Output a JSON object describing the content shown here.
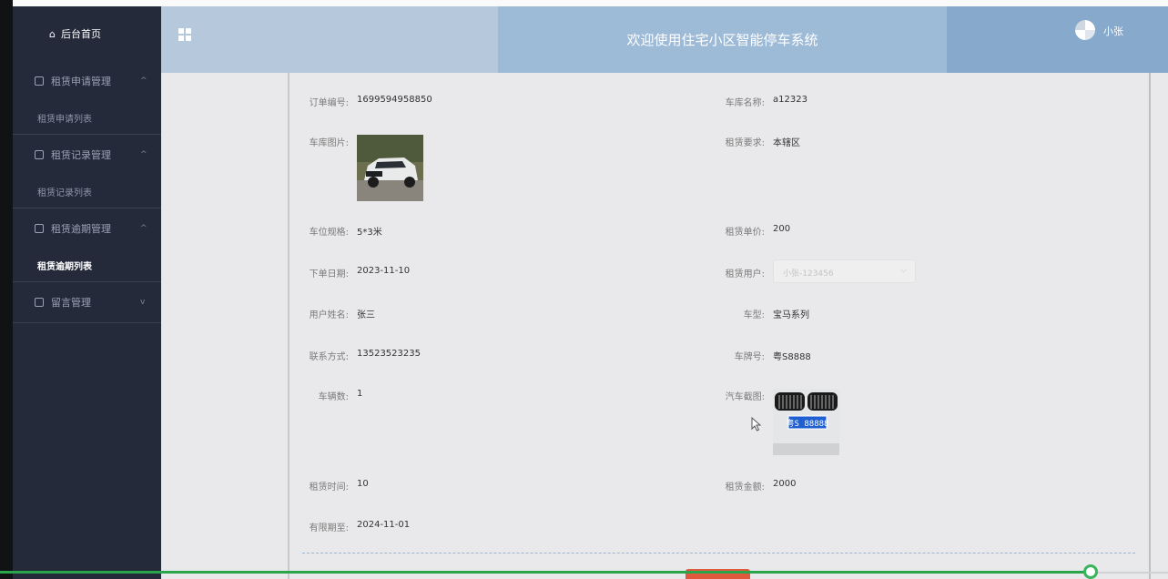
{
  "header": {
    "title": "欢迎使用住宅小区智能停车系统",
    "username": "小张"
  },
  "sidebar": {
    "home": "后台首页",
    "groups": [
      {
        "title": "租赁申请管理",
        "chevron": "^",
        "items": [
          "租赁申请列表"
        ]
      },
      {
        "title": "租赁记录管理",
        "chevron": "^",
        "items": [
          "租赁记录列表"
        ]
      },
      {
        "title": "租赁逾期管理",
        "chevron": "^",
        "items": [
          "租赁逾期列表"
        ]
      },
      {
        "title": "留言管理",
        "chevron": "v",
        "items": []
      }
    ]
  },
  "form": {
    "order_no": {
      "label": "订单编号:",
      "value": "1699594958850"
    },
    "garage_name": {
      "label": "车库名称:",
      "value": "a12323"
    },
    "garage_image": {
      "label": "车库图片:"
    },
    "rent_requirement": {
      "label": "租赁要求:",
      "value": "本辖区"
    },
    "space_spec": {
      "label": "车位规格:",
      "value": "5*3米"
    },
    "unit_price": {
      "label": "租赁单价:",
      "value": "200"
    },
    "order_date": {
      "label": "下单日期:",
      "value": "2023-11-10"
    },
    "rent_user": {
      "label": "租赁用户:",
      "value": "小张-123456"
    },
    "user_name": {
      "label": "用户姓名:",
      "value": "张三"
    },
    "car_model": {
      "label": "车型:",
      "value": "宝马系列"
    },
    "contact": {
      "label": "联系方式:",
      "value": "13523523235"
    },
    "plate_no": {
      "label": "车牌号:",
      "value": "粤S8888"
    },
    "vehicle_count": {
      "label": "车辆数:",
      "value": "1"
    },
    "car_screenshot": {
      "label": "汽车截图:",
      "plate_text": "粤S 88888"
    },
    "rent_time": {
      "label": "租赁时间:",
      "value": "10"
    },
    "rent_amount": {
      "label": "租赁金额:",
      "value": "2000"
    },
    "valid_until": {
      "label": "有限期至:",
      "value": "2024-11-01"
    }
  },
  "playback": {
    "progress": 0.934
  },
  "colors": {
    "sidebar_bg": "#252a3a",
    "header": "#9dbad7",
    "progress": "#2aa54b",
    "button": "#e1593d"
  }
}
